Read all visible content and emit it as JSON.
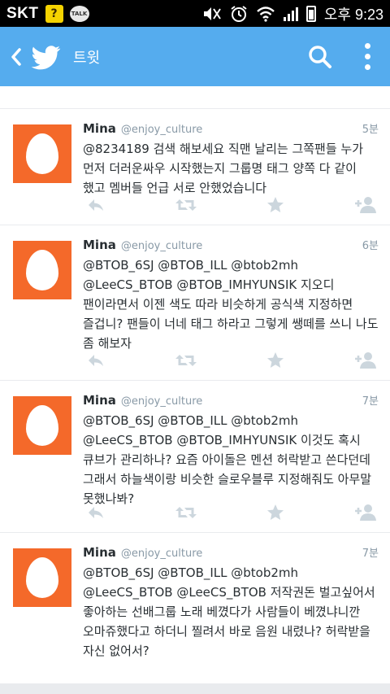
{
  "status_bar": {
    "carrier": "SKT",
    "kakao_badge": "?",
    "talk_badge": "TALK",
    "clock": "오후 9:23"
  },
  "header": {
    "title": "트윗",
    "accent": "#55acee"
  },
  "icons": {
    "back": "chevron-left-icon",
    "logo": "twitter-bird-icon",
    "search": "search-icon",
    "more": "more-vertical-icon",
    "reply": "reply-icon",
    "retweet": "retweet-icon",
    "favorite": "star-icon",
    "follow": "add-user-icon"
  },
  "tweets": [
    {
      "name": "Mina",
      "handle": "@enjoy_culture",
      "time": "5분",
      "text": "@8234189 검색 해보세요 직맨 날리는 그쪽팬들 누가 먼저 더러운싸우 시작했는지 그룹명 태그 양쪽 다 같이 했고 멤버들 언급 서로 안했었습니다"
    },
    {
      "name": "Mina",
      "handle": "@enjoy_culture",
      "time": "6분",
      "text": "@BTOB_6SJ @BTOB_ILL @btob2mh @LeeCS_BTOB @BTOB_IMHYUNSIK 지오디 팬이라면서 이젠 색도 따라 비슷하게 공식색 지정하면 즐겁니? 팬들이 너네 태그 하라고 그렇게 쌩떼를 쓰니 나도 좀 해보자"
    },
    {
      "name": "Mina",
      "handle": "@enjoy_culture",
      "time": "7분",
      "text": "@BTOB_6SJ @BTOB_ILL @btob2mh @LeeCS_BTOB @BTOB_IMHYUNSIK 이것도 혹시 큐브가 관리하나? 요즘 아이돌은 멘션 허락받고 쓴다던데 그래서 하늘색이랑 비슷한 슬로우블루 지정해줘도 아무말 못했나봐?"
    },
    {
      "name": "Mina",
      "handle": "@enjoy_culture",
      "time": "7분",
      "text": "@BTOB_6SJ @BTOB_ILL @btob2mh @LeeCS_BTOB @LeeCS_BTOB 저작권돈 벌고싶어서 좋아하는 선배그룹 노래 베꼈다가 사람들이 베꼈냐니깐 오마쥬했다고 하더니 찔려서 바로 음원 내렸나? 허락받을 자신 없어서?"
    }
  ]
}
